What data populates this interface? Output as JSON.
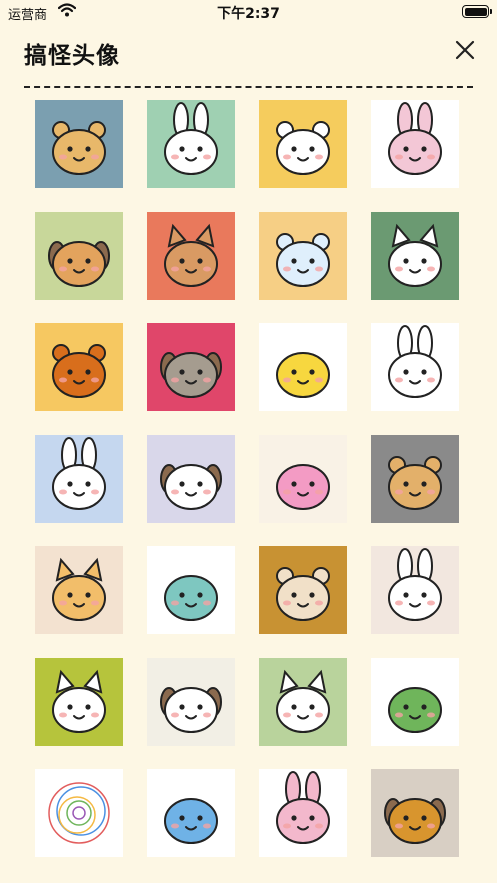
{
  "status_bar": {
    "carrier": "运营商",
    "time": "下午2:37"
  },
  "header": {
    "title": "搞怪头像"
  },
  "avatars": [
    {
      "name": "avatar-bear-phone",
      "bg": "#7b9fb0",
      "fg": "#e8b86a",
      "kind": "bear"
    },
    {
      "name": "avatar-bunny-chair",
      "bg": "#9fd0b2",
      "fg": "#ffffff",
      "kind": "bunny"
    },
    {
      "name": "avatar-bear-sunburst",
      "bg": "#f5cc5d",
      "fg": "#ffffff",
      "kind": "bear"
    },
    {
      "name": "avatar-bunny-sunglasses",
      "bg": "#ffffff",
      "fg": "#f3c7d6",
      "kind": "bunny"
    },
    {
      "name": "avatar-shiba",
      "bg": "#c8d79a",
      "fg": "#e3a35d",
      "kind": "dog"
    },
    {
      "name": "avatar-cat-rays",
      "bg": "#e9795c",
      "fg": "#d99a63",
      "kind": "cat"
    },
    {
      "name": "avatar-bear-blue",
      "bg": "#f6cf85",
      "fg": "#dfeffc",
      "kind": "bear"
    },
    {
      "name": "avatar-cat-selfie",
      "bg": "#6b9a72",
      "fg": "#ffffff",
      "kind": "cat"
    },
    {
      "name": "avatar-orange-bear",
      "bg": "#f6c861",
      "fg": "#d86e1c",
      "kind": "bear"
    },
    {
      "name": "avatar-dog-sunglasses",
      "bg": "#e0466a",
      "fg": "#a59c8f",
      "kind": "dog"
    },
    {
      "name": "avatar-chick",
      "bg": "#ffffff",
      "fg": "#f7d73f",
      "kind": "blob"
    },
    {
      "name": "avatar-bunny-swirl",
      "bg": "#ffffff",
      "fg": "#ffffff",
      "kind": "bunny"
    },
    {
      "name": "avatar-bunny-bed",
      "bg": "#c5d7ef",
      "fg": "#ffffff",
      "kind": "bunny"
    },
    {
      "name": "avatar-dog-laptop",
      "bg": "#d9d7ea",
      "fg": "#ffffff",
      "kind": "dog"
    },
    {
      "name": "avatar-kid-rainbow",
      "bg": "#f9f2e6",
      "fg": "#f39bc4",
      "kind": "blob"
    },
    {
      "name": "avatar-bear-fish",
      "bg": "#8a8a8a",
      "fg": "#e3b06a",
      "kind": "bear"
    },
    {
      "name": "avatar-cat-cake",
      "bg": "#f3e2d0",
      "fg": "#f2be6a",
      "kind": "cat"
    },
    {
      "name": "avatar-monster-doodle",
      "bg": "#ffffff",
      "fg": "#7ec7c0",
      "kind": "blob"
    },
    {
      "name": "avatar-hamster",
      "bg": "#c89233",
      "fg": "#f1e0c8",
      "kind": "bear"
    },
    {
      "name": "avatar-bunny-blush",
      "bg": "#f2e7df",
      "fg": "#ffffff",
      "kind": "bunny"
    },
    {
      "name": "avatar-cat-cup",
      "bg": "#b6c43c",
      "fg": "#ffffff",
      "kind": "cat"
    },
    {
      "name": "avatar-dog-seat",
      "bg": "#f2efe5",
      "fg": "#ffffff",
      "kind": "dog"
    },
    {
      "name": "avatar-cat-fish",
      "bg": "#b9d39c",
      "fg": "#ffffff",
      "kind": "cat"
    },
    {
      "name": "avatar-frog-party",
      "bg": "#ffffff",
      "fg": "#6fb55b",
      "kind": "blob"
    },
    {
      "name": "avatar-scribble",
      "bg": "#ffffff",
      "fg": "#ffffff",
      "kind": "scribble"
    },
    {
      "name": "avatar-fish-monster",
      "bg": "#ffffff",
      "fg": "#6fb2e6",
      "kind": "blob"
    },
    {
      "name": "avatar-bunny-laptop",
      "bg": "#ffffff",
      "fg": "#f3b8cc",
      "kind": "bunny"
    },
    {
      "name": "avatar-dog-sofa",
      "bg": "#d8cfc4",
      "fg": "#d8952e",
      "kind": "dog"
    }
  ]
}
